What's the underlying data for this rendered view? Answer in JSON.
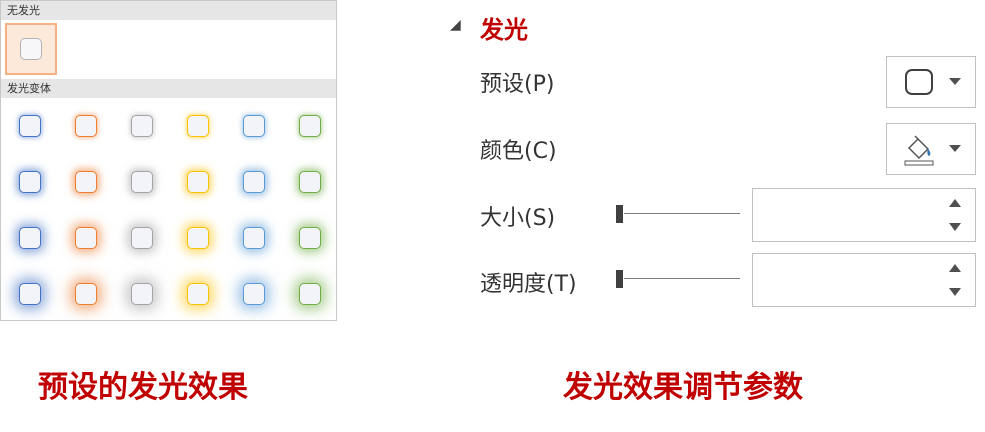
{
  "gallery": {
    "no_glow_label": "无发光",
    "variants_label": "发光变体",
    "glow_colors": [
      "#4472c4",
      "#ed7d31",
      "#a5a5a5",
      "#ffc000",
      "#5b9bd5",
      "#70ad47"
    ],
    "glow_levels": [
      1,
      2,
      3,
      4
    ]
  },
  "panel": {
    "title": "发光",
    "preset_label": "预设(P)",
    "color_label": "颜色(C)",
    "size_label": "大小(S)",
    "transparency_label": "透明度(T)",
    "size_value": "",
    "transparency_value": ""
  },
  "captions": {
    "left": "预设的发光效果",
    "right": "发光效果调节参数"
  },
  "colors": {
    "accent_red": "#c00000",
    "selected_border": "#f4b183"
  }
}
